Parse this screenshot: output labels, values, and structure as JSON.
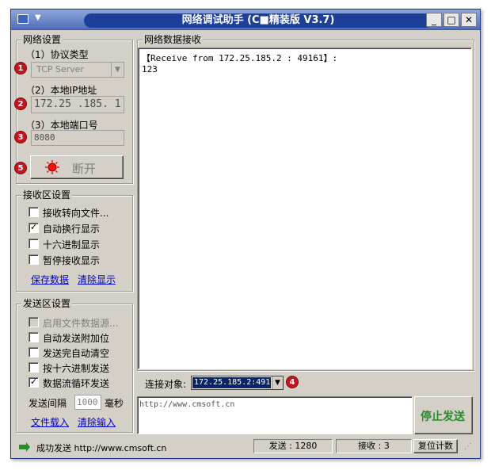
{
  "window": {
    "title": "网络调试助手 (C■精装版 V3.7)"
  },
  "network": {
    "group_title": "网络设置",
    "protocol_label": "（1）协议类型",
    "protocol_value": "TCP Server",
    "ip_label": "（2）本地IP地址",
    "ip_value": "172.25 .185. 1",
    "port_label": "（3）本地端口号",
    "port_value": "8080",
    "disconnect_label": "断开",
    "badges": [
      "1",
      "2",
      "3",
      "5"
    ]
  },
  "receive": {
    "group_title": "接收区设置",
    "options": [
      {
        "label": "接收转向文件...",
        "checked": false
      },
      {
        "label": "自动换行显示",
        "checked": true
      },
      {
        "label": "十六进制显示",
        "checked": false
      },
      {
        "label": "暂停接收显示",
        "checked": false
      }
    ],
    "save_label": "保存数据",
    "clear_label": "清除显示"
  },
  "send": {
    "group_title": "发送区设置",
    "options": [
      {
        "label": "启用文件数据源...",
        "checked": false,
        "disabled": true
      },
      {
        "label": "自动发送附加位",
        "checked": false
      },
      {
        "label": "发送完自动清空",
        "checked": false
      },
      {
        "label": "按十六进制发送",
        "checked": false
      },
      {
        "label": "数据流循环发送",
        "checked": true
      }
    ],
    "interval_label": "发送间隔",
    "interval_value": "1000",
    "interval_unit": "毫秒",
    "load_file_label": "文件载入",
    "clear_input_label": "清除输入"
  },
  "data_area": {
    "group_title": "网络数据接收",
    "header_line": "【Receive from 172.25.185.2 : 49161】:",
    "body_line": "123"
  },
  "connect": {
    "label": "连接对象:",
    "target_value": "172.25.185.2:491",
    "badge": "4"
  },
  "send_area": {
    "text": "http://www.cmsoft.cn",
    "stop_button_label": "停止发送"
  },
  "status": {
    "message": "成功发送 http://www.cmsoft.cn",
    "sent": "发送 : 1280",
    "received": "接收 : 3",
    "reset_label": "复位计数"
  },
  "colors": {
    "accent": "#1d3f9a",
    "badge": "#c8141e",
    "link": "#0000cc",
    "stop_text": "#2a8a2a"
  }
}
